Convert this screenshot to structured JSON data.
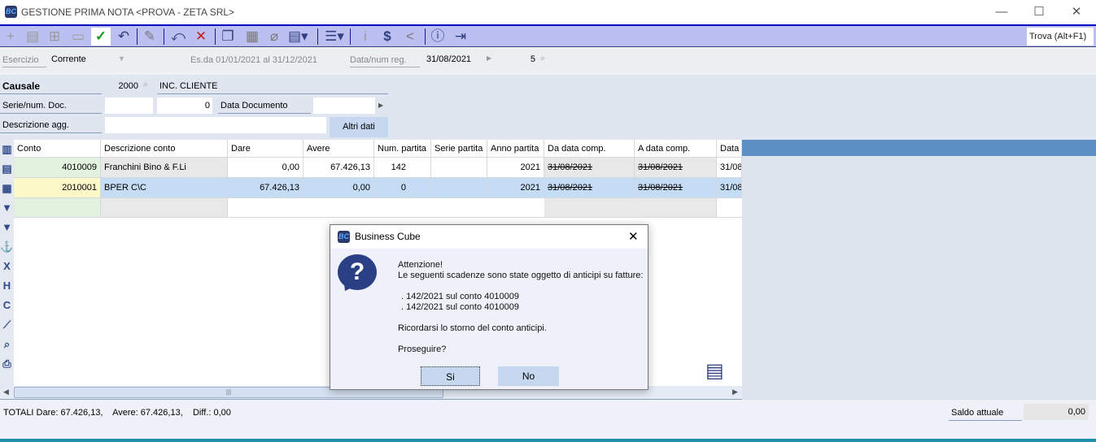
{
  "window": {
    "title": "GESTIONE PRIMA NOTA <PROVA - ZETA SRL>",
    "logo": "BC",
    "minimize": "—",
    "maximize": "☐",
    "close": "✕"
  },
  "toolbar": {
    "search_placeholder": "Trova (Alt+F1)",
    "icons": [
      "plus-icon",
      "new-list-icon",
      "add-window-icon",
      "folder-icon",
      "check-icon",
      "undo-icon",
      "pencil-icon",
      "revert-icon",
      "delete-icon",
      "copy-icon",
      "calendar-search-icon",
      "attach-icon",
      "document-icon",
      "menu-icon",
      "info-icon",
      "dollar-icon",
      "share-icon",
      "help-icon",
      "exit-icon"
    ]
  },
  "filter": {
    "esercizio_label": "Esercizio",
    "esercizio_value": "Corrente",
    "period": "Es.da 01/01/2021 al 31/12/2021",
    "data_label": "Data/num reg.",
    "data_value": "31/08/2021",
    "num_value": "5"
  },
  "form": {
    "causale_label": "Causale",
    "causale_code": "2000",
    "causale_desc": "INC. CLIENTE",
    "serie_label": "Serie/num. Doc.",
    "serie_value": "",
    "num_doc": "0",
    "data_doc_label": "Data Documento",
    "data_doc_value": "",
    "descr_label": "Descrizione agg.",
    "descr_value": "",
    "altri_dati": "Altri dati"
  },
  "grid": {
    "columns": [
      "Conto",
      "Descrizione conto",
      "Dare",
      "Avere",
      "Num. partita",
      "Serie partita",
      "Anno partita",
      "Da data comp.",
      "A data comp.",
      "Data"
    ],
    "rows": [
      [
        "4010009",
        "Franchini Bino & F.Li",
        "0,00",
        "67.426,13",
        "142",
        "",
        "2021",
        "31/08/2021",
        "31/08/2021",
        "31/08"
      ],
      [
        "2010001",
        "BPER C\\C",
        "67.426,13",
        "0,00",
        "0",
        "",
        "2021",
        "31/08/2021",
        "31/08/2021",
        "31/08"
      ]
    ]
  },
  "footer": {
    "totals": "TOTALI Dare: 67.426,13,    Avere: 67.426,13,    Diff.: 0,00",
    "saldo_label": "Saldo attuale",
    "saldo_value": "0,00"
  },
  "dialog": {
    "title": "Business Cube",
    "line1": "Attenzione!",
    "line2": "Le seguenti scadenze sono state oggetto di anticipi su fatture:",
    "item1": ". 142/2021 sul conto 4010009",
    "item2": ". 142/2021 sul conto 4010009",
    "line3": "Ricordarsi lo storno del conto anticipi.",
    "line4": "Proseguire?",
    "yes": "Si",
    "no": "No",
    "close": "✕"
  }
}
